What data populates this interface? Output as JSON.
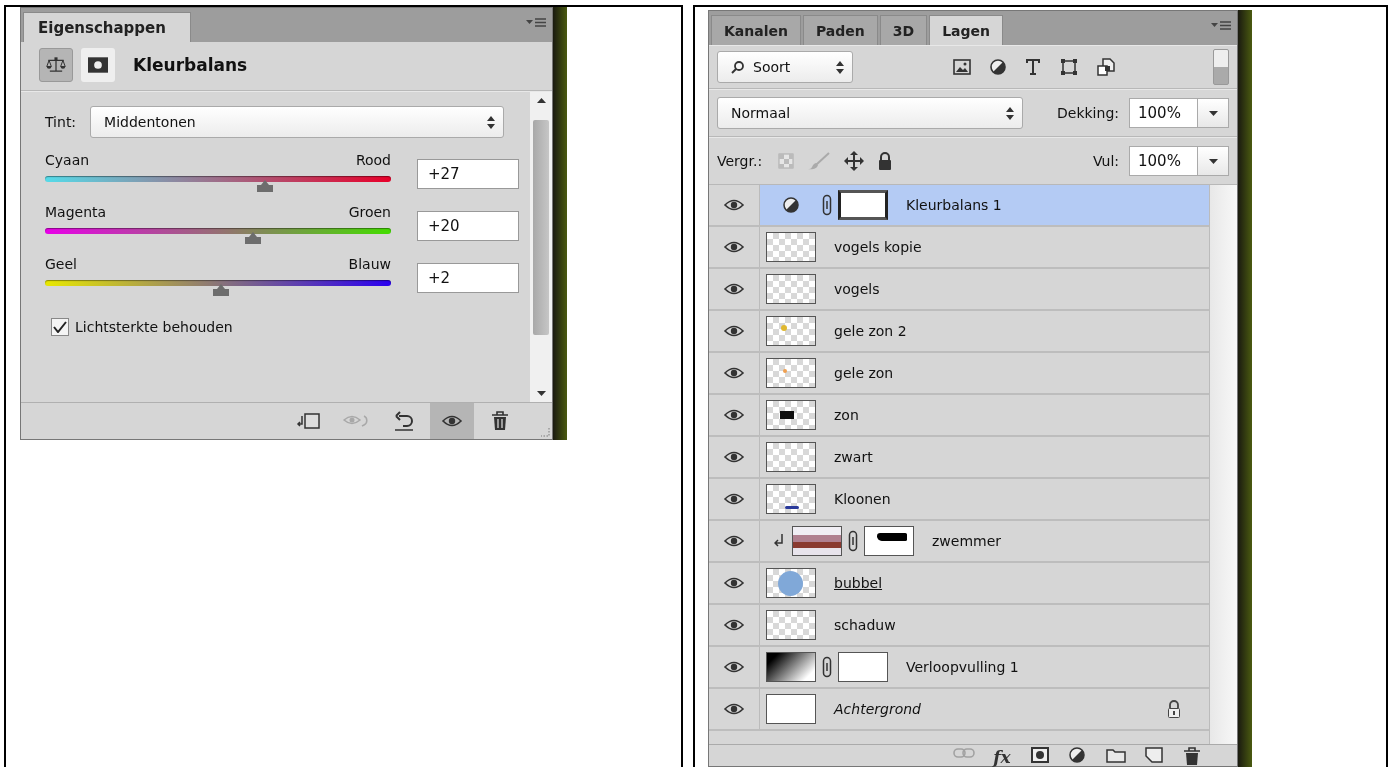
{
  "properties": {
    "tab": "Eigenschappen",
    "heading_icons": [
      {
        "kind": "adjustment",
        "selected": true
      },
      {
        "kind": "mask",
        "selected": false
      }
    ],
    "heading": "Kleurbalans",
    "tint_label": "Tint:",
    "tint_value": "Middentonen",
    "sliders": [
      {
        "left": "Cyaan",
        "right": "Rood",
        "value": "+27",
        "level": 0.635,
        "kind": "cyan-red"
      },
      {
        "left": "Magenta",
        "right": "Groen",
        "value": "+20",
        "level": 0.6,
        "kind": "magenta-green"
      },
      {
        "left": "Geel",
        "right": "Blauw",
        "value": "+2",
        "level": 0.51,
        "kind": "yellow-blue"
      }
    ],
    "checkbox": {
      "label": "Lichtsterkte behouden",
      "checked": true
    },
    "footer_buttons": [
      {
        "kind": "clip",
        "disabled": false,
        "pressed": false
      },
      {
        "kind": "previous",
        "disabled": true,
        "pressed": false
      },
      {
        "kind": "reset",
        "disabled": false,
        "pressed": false
      },
      {
        "kind": "visibility",
        "disabled": false,
        "pressed": true
      },
      {
        "kind": "delete",
        "disabled": false,
        "pressed": false
      }
    ]
  },
  "layers_panel": {
    "tabs": [
      {
        "label": "Kanalen",
        "selected": false
      },
      {
        "label": "Paden",
        "selected": false
      },
      {
        "label": "3D",
        "selected": false
      },
      {
        "label": "Lagen",
        "selected": true
      }
    ],
    "filter": "Soort",
    "filter_icons": [
      {
        "kind": "image"
      },
      {
        "kind": "adjustment"
      },
      {
        "kind": "type"
      },
      {
        "kind": "shape"
      },
      {
        "kind": "smart"
      }
    ],
    "blend_mode": "Normaal",
    "opacity_label": "Dekking:",
    "opacity": "100%",
    "lock_label": "Vergr.:",
    "lock_icons": [
      {
        "kind": "transparency"
      },
      {
        "kind": "paint"
      },
      {
        "kind": "move"
      },
      {
        "kind": "all"
      }
    ],
    "fill_label": "Vul:",
    "fill": "100%",
    "layers": [
      {
        "name": "Kleurbalans 1",
        "thumb": {
          "kind": "adjustment"
        },
        "mask": {
          "kind": "white",
          "targeted": true
        },
        "selected": true,
        "visible": true,
        "clipped": false,
        "locked": false,
        "italic": false,
        "underlined": false
      },
      {
        "name": "vogels kopie",
        "thumb": {
          "kind": "transparent"
        },
        "selected": false,
        "visible": true,
        "clipped": false,
        "locked": false,
        "italic": false,
        "underlined": false
      },
      {
        "name": "vogels",
        "thumb": {
          "kind": "transparent"
        },
        "selected": false,
        "visible": true,
        "clipped": false,
        "locked": false,
        "italic": false,
        "underlined": false
      },
      {
        "name": "gele zon 2",
        "thumb": {
          "kind": "yellow-dot"
        },
        "selected": false,
        "visible": true,
        "clipped": false,
        "locked": false,
        "italic": false,
        "underlined": false
      },
      {
        "name": "gele zon",
        "thumb": {
          "kind": "orange-dot"
        },
        "selected": false,
        "visible": true,
        "clipped": false,
        "locked": false,
        "italic": false,
        "underlined": false
      },
      {
        "name": "zon",
        "thumb": {
          "kind": "black-block"
        },
        "selected": false,
        "visible": true,
        "clipped": false,
        "locked": false,
        "italic": false,
        "underlined": false
      },
      {
        "name": "zwart",
        "thumb": {
          "kind": "transparent"
        },
        "selected": false,
        "visible": true,
        "clipped": false,
        "locked": false,
        "italic": false,
        "underlined": false
      },
      {
        "name": "Kloonen",
        "thumb": {
          "kind": "blue-mark"
        },
        "selected": false,
        "visible": true,
        "clipped": false,
        "locked": false,
        "italic": false,
        "underlined": false
      },
      {
        "name": "zwemmer",
        "thumb": {
          "kind": "photo"
        },
        "mask": {
          "kind": "shape",
          "targeted": false
        },
        "selected": false,
        "visible": true,
        "clipped": true,
        "locked": false,
        "italic": false,
        "underlined": false
      },
      {
        "name": "bubbel",
        "thumb": {
          "kind": "bubble"
        },
        "selected": false,
        "visible": true,
        "clipped": false,
        "locked": false,
        "italic": false,
        "underlined": true
      },
      {
        "name": "schaduw",
        "thumb": {
          "kind": "transparent"
        },
        "selected": false,
        "visible": true,
        "clipped": false,
        "locked": false,
        "italic": false,
        "underlined": false
      },
      {
        "name": "Verloopvulling 1",
        "thumb": {
          "kind": "gradient"
        },
        "mask": {
          "kind": "white",
          "targeted": false
        },
        "selected": false,
        "visible": true,
        "clipped": false,
        "locked": false,
        "italic": false,
        "underlined": false
      },
      {
        "name": "Achtergrond",
        "thumb": {
          "kind": "white"
        },
        "selected": false,
        "visible": true,
        "clipped": false,
        "locked": true,
        "italic": true,
        "underlined": false
      }
    ],
    "footer_buttons": [
      {
        "kind": "link",
        "disabled": true
      },
      {
        "kind": "fx",
        "label": "fx",
        "disabled": false
      },
      {
        "kind": "mask",
        "disabled": false
      },
      {
        "kind": "adjustment",
        "disabled": false
      },
      {
        "kind": "folder",
        "disabled": false
      },
      {
        "kind": "new",
        "disabled": false
      },
      {
        "kind": "delete",
        "disabled": false
      }
    ]
  }
}
